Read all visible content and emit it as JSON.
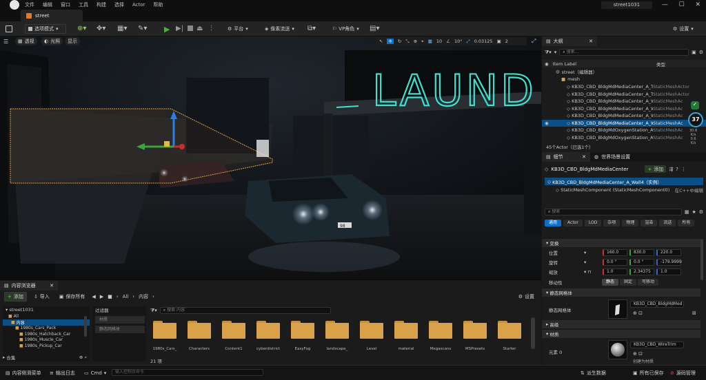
{
  "menubar": {
    "items": [
      "文件",
      "编辑",
      "窗口",
      "工具",
      "构建",
      "选择",
      "Actor",
      "帮助"
    ],
    "project": "street1031"
  },
  "tab": {
    "label": "street"
  },
  "toolbar": {
    "mode": "选项模式",
    "platform": "平台",
    "pixel_streaming": "像素流送",
    "vp_role": "VP角色",
    "settings": "设置"
  },
  "viewport": {
    "perspective": "透视",
    "lit": "光照",
    "show": "显示",
    "grid_snap": "10",
    "angle_snap": "10°",
    "scale_snap": "0.03125",
    "cam_speed": "2",
    "sign_text": "LAUND",
    "plate_text": "98"
  },
  "outliner": {
    "title": "大纲",
    "search_placeholder": "搜索...",
    "col_label": "Item Label",
    "col_type": "类型",
    "root": "street（编辑器）",
    "folder": "mesh",
    "rows": [
      {
        "label": "KB3D_CBD_BldgMdMediaCenter_A_Tr",
        "type": "StaticMeshActor"
      },
      {
        "label": "KB3D_CBD_BldgMdMediaCenter_A_Tr",
        "type": "StaticMeshActor"
      },
      {
        "label": "KB3D_CBD_BldgMdMediaCenter_A_W",
        "type": "StaticMeshAc"
      },
      {
        "label": "KB3D_CBD_BldgMdMediaCenter_A_W",
        "type": "StaticMeshAc"
      },
      {
        "label": "KB3D_CBD_BldgMdMediaCenter_A_W",
        "type": "StaticMeshAc"
      },
      {
        "label": "KB3D_CBD_BldgMdMediaCenter_A_W",
        "type": "StaticMeshAc"
      },
      {
        "label": "KB3D_CBD_BldgMdOxygenStation_A_",
        "type": "StaticMeshAc"
      },
      {
        "label": "KB3D_CBD_BldgMdOxygenStation_A_",
        "type": "StaticMeshAc"
      }
    ],
    "footer": "45个Actor（已选1个）",
    "perf_fps": "37",
    "perf_up": "30.8",
    "perf_down": "0.6",
    "perf_unit": "K/s"
  },
  "details": {
    "tab": "细节",
    "tab2": "世界场景设置",
    "actor_name": "KB3D_CBD_BldgMdMediaCenter",
    "add": "添加",
    "instance": "KB3D_CBD_BldgMdMediaCenter_A_Wall4（实例）",
    "component": "StaticMeshComponent (StaticMeshComponent0)",
    "edit_cpp": "在C++中编辑",
    "search_placeholder": "搜索",
    "filters": [
      "通用",
      "Actor",
      "LOD",
      "杂项",
      "物理",
      "渲染",
      "流送",
      "所有"
    ],
    "transform": "变换",
    "location_label": "位置",
    "rotation_label": "旋转",
    "scale_label": "缩放",
    "location": [
      "160.0",
      "830.0",
      "220.0"
    ],
    "rotation": [
      "0.0 °",
      "0.0 °",
      "-179.9999"
    ],
    "scale": [
      "1.0",
      "2.34375",
      "1.0"
    ],
    "mobility_label": "移动性",
    "mobility": [
      "静态",
      "固定",
      "可移动"
    ],
    "static_mesh_section": "静态网格体",
    "static_mesh_label": "静态网格体",
    "static_mesh_value": "KB3D_CBD_BldgMdMed",
    "advanced": "高级",
    "materials": "材质",
    "element0": "元素 0",
    "material_value": "KB3D_CBD_WireTrim",
    "material_sub": "创建为材质"
  },
  "content": {
    "title": "内容浏览器",
    "add": "添加",
    "import": "导入",
    "save_all": "保存所有",
    "path_all": "All",
    "path_content": "内容",
    "settings": "设置",
    "source_root": "street1031",
    "tree": [
      "All",
      "内容",
      "1980s_Cars_Pack",
      "1980s_Hatchback_Car",
      "1980s_Muscle_Car",
      "1980s_Pickup_Car"
    ],
    "collections": "合集",
    "filters_title": "过滤器",
    "filter_items": [
      "材质",
      "静态网格体"
    ],
    "search_placeholder": "搜索 内容",
    "folders": [
      "1980s_Cars_",
      "Characters",
      "Content1",
      "cyberdistrict",
      "EasyFog",
      "landscape_",
      "Level",
      "material",
      "Megascans",
      "MSPresets",
      "Starter"
    ],
    "count": "21 项"
  },
  "statusbar": {
    "drawer": "内容侧滑菜单",
    "log": "输出日志",
    "cmd": "Cmd",
    "cmd_placeholder": "输入控制台命令",
    "derived": "派生数据",
    "saved": "所有已保存",
    "source": "源码管理"
  },
  "colors": {
    "accent": "#0a70c9",
    "selection": "#0a4f86",
    "play": "#4caf3c",
    "folder": "#d9a14a",
    "neon": "#3fe0cf"
  }
}
